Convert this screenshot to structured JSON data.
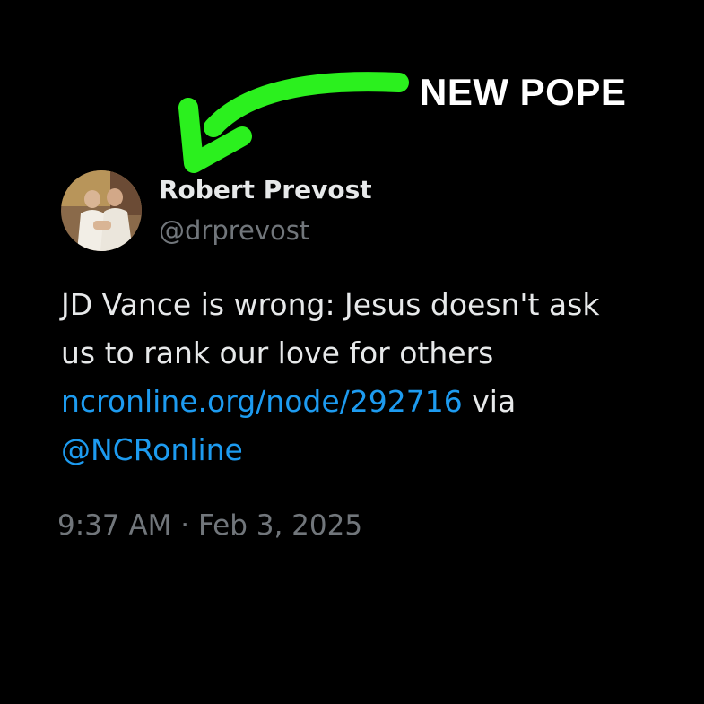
{
  "annotation": {
    "label": "NEW POPE",
    "arrow_icon": "green-curved-arrow",
    "arrow_color": "#2bf01e"
  },
  "tweet": {
    "author": {
      "display_name": "Robert Prevost",
      "handle": "@drprevost",
      "avatar_icon": "profile-photo"
    },
    "text": {
      "line1": "JD Vance is wrong: Jesus doesn't ask",
      "line2": "us to rank our love for others",
      "link": "ncronline.org/node/292716",
      "via": " via",
      "mention": "@NCRonline"
    },
    "timestamp": {
      "time": "9:37 AM",
      "separator": " · ",
      "date": "Feb 3, 2025"
    }
  },
  "colors": {
    "background": "#000000",
    "text_primary": "#e7e9ea",
    "text_secondary": "#71767b",
    "link": "#1d9bf0"
  }
}
